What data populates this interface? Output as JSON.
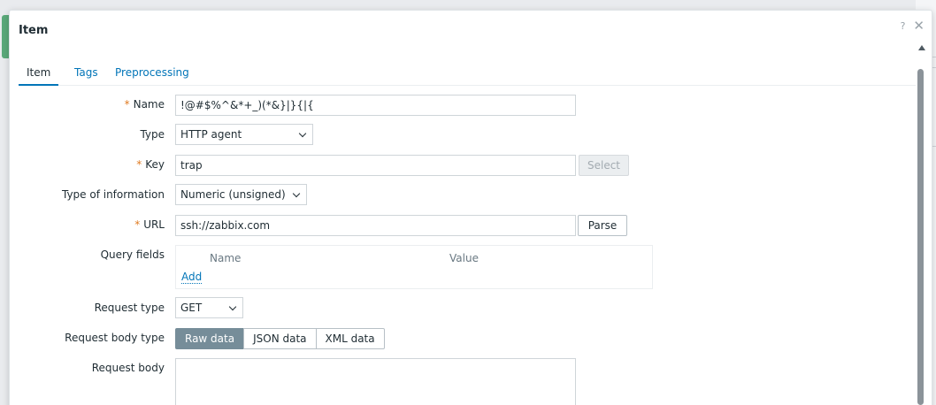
{
  "dialog": {
    "title": "Item",
    "help_icon": "question-icon",
    "close_icon": "close-icon"
  },
  "tabs": [
    {
      "label": "Item",
      "active": true
    },
    {
      "label": "Tags",
      "active": false
    },
    {
      "label": "Preprocessing",
      "active": false
    }
  ],
  "form": {
    "name": {
      "label": "Name",
      "required": "*",
      "value": "!@#$%^&*+_)(*&}|}{|{"
    },
    "type": {
      "label": "Type",
      "value": "HTTP agent"
    },
    "key": {
      "label": "Key",
      "required": "*",
      "value": "trap",
      "select_button": "Select"
    },
    "type_of_information": {
      "label": "Type of information",
      "value": "Numeric (unsigned)"
    },
    "url": {
      "label": "URL",
      "required": "*",
      "value": "ssh://zabbix.com",
      "parse_button": "Parse"
    },
    "query_fields": {
      "label": "Query fields",
      "col_name": "Name",
      "col_value": "Value",
      "add_link": "Add"
    },
    "request_type": {
      "label": "Request type",
      "value": "GET"
    },
    "request_body_type": {
      "label": "Request body type",
      "options": [
        "Raw data",
        "JSON data",
        "XML data"
      ],
      "selected": "Raw data"
    },
    "request_body": {
      "label": "Request body",
      "value": ""
    }
  },
  "colors": {
    "accent": "#0275b8",
    "required": "#e07b22",
    "segmented_active": "#768d99"
  }
}
